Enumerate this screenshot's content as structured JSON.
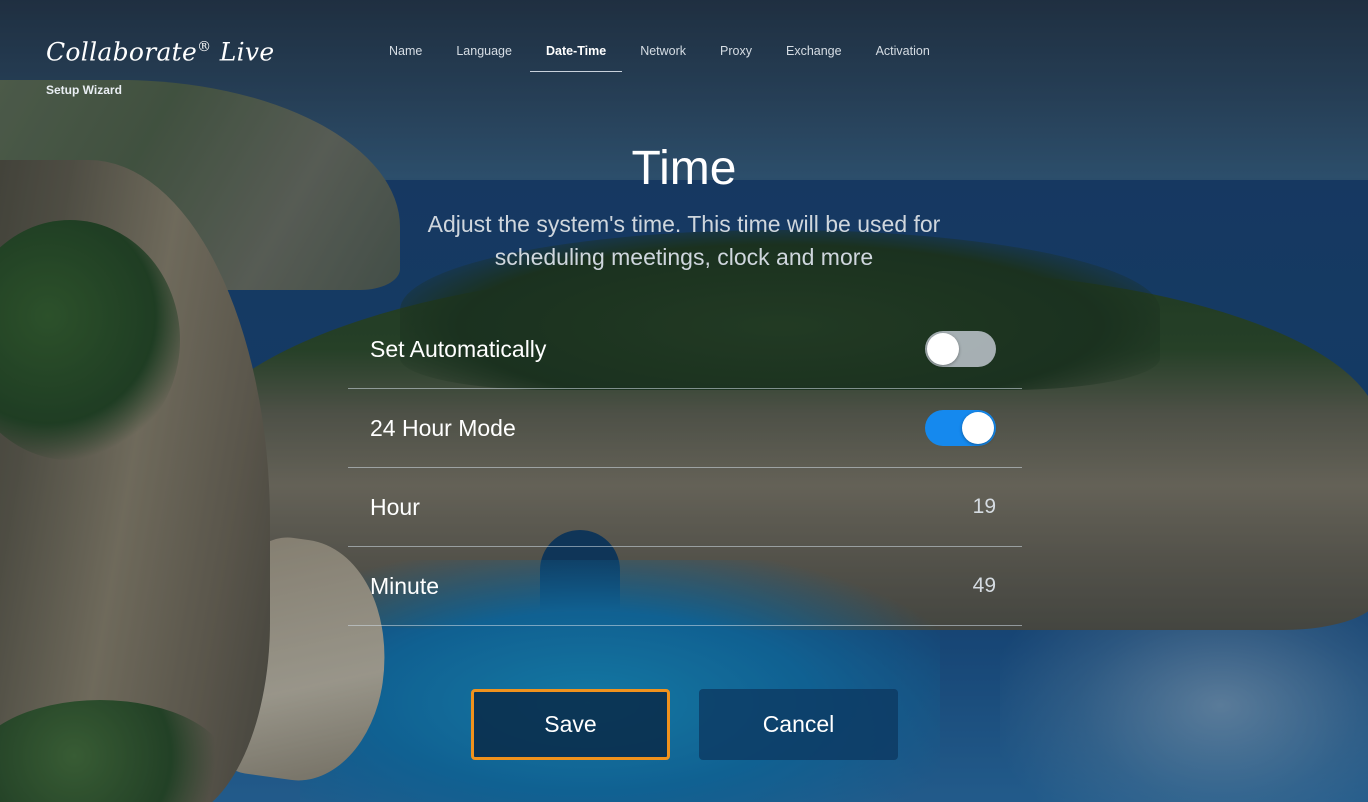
{
  "brand": {
    "logo_text": "Collaborate",
    "logo_reg": "®",
    "logo_text2": " Live",
    "subtitle": "Setup Wizard"
  },
  "nav": {
    "items": [
      {
        "label": "Name"
      },
      {
        "label": "Language"
      },
      {
        "label": "Date-Time"
      },
      {
        "label": "Network"
      },
      {
        "label": "Proxy"
      },
      {
        "label": "Exchange"
      },
      {
        "label": "Activation"
      }
    ],
    "active": "Date-Time"
  },
  "page": {
    "title": "Time",
    "description": "Adjust the system's time. This time will be used for scheduling meetings, clock and more"
  },
  "settings": {
    "set_automatically": {
      "label": "Set Automatically",
      "enabled": false
    },
    "hour_mode_24": {
      "label": "24 Hour Mode",
      "enabled": true
    },
    "hour": {
      "label": "Hour",
      "value": "19"
    },
    "minute": {
      "label": "Minute",
      "value": "49"
    }
  },
  "buttons": {
    "save": "Save",
    "cancel": "Cancel"
  },
  "colors": {
    "toggle_on": "#1589ee",
    "focus_border": "#f0921d"
  }
}
